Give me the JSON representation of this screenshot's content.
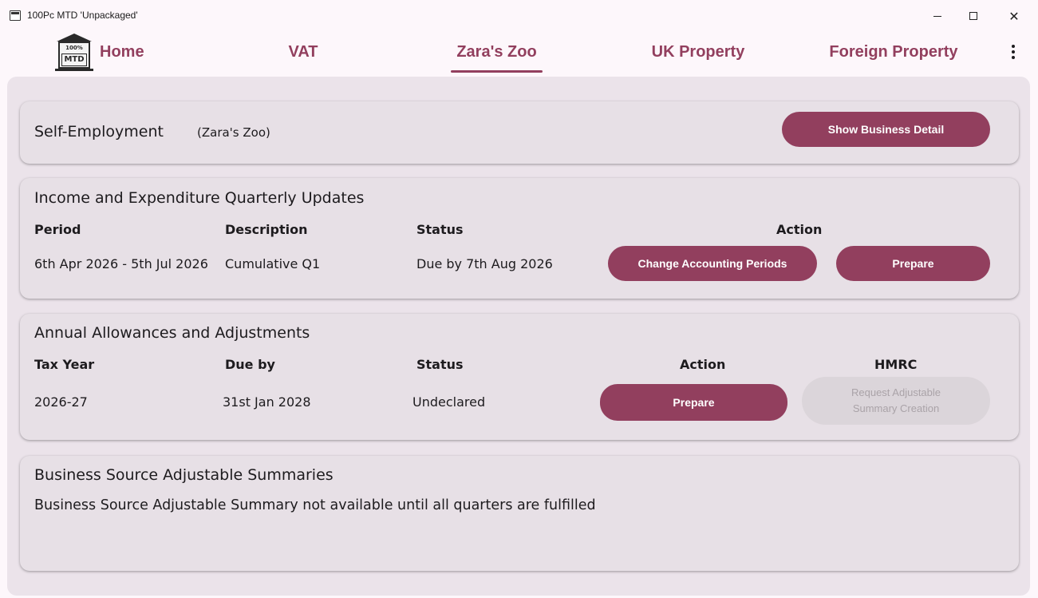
{
  "window": {
    "title": "100Pc MTD 'Unpackaged'",
    "minimize_icon": "minimize-icon",
    "maximize_icon": "maximize-icon",
    "close_glyph": "✕"
  },
  "logo": {
    "pct": "100%",
    "mtd": "MTD"
  },
  "nav": {
    "tabs": [
      {
        "label": "Home"
      },
      {
        "label": "VAT"
      },
      {
        "label": "Zara's Zoo",
        "selected": true
      },
      {
        "label": "UK Property"
      },
      {
        "label": "Foreign Property"
      }
    ],
    "menu_icon": "more-vert-icon"
  },
  "colors": {
    "accent": "#923f5e",
    "card_bg": "#e7e0e6",
    "main_bg": "#ebe3ea",
    "disabled_bg": "#dbd5da"
  },
  "self_employment": {
    "title": "Self-Employment",
    "business": "(Zara's Zoo)",
    "show_detail_button": "Show Business Detail"
  },
  "quarterly": {
    "title": "Income and Expenditure Quarterly Updates",
    "headers": {
      "period": "Period",
      "description": "Description",
      "status": "Status",
      "action": "Action"
    },
    "row": {
      "period": "6th Apr 2026 - 5th Jul 2026",
      "description": "Cumulative Q1",
      "status": "Due by 7th Aug 2026",
      "change_button": "Change Accounting Periods",
      "prepare_button": "Prepare"
    }
  },
  "annual": {
    "title": "Annual Allowances and Adjustments",
    "headers": {
      "tax_year": "Tax Year",
      "due_by": "Due by",
      "status": "Status",
      "action": "Action",
      "hmrc": "HMRC"
    },
    "row": {
      "tax_year": "2026-27",
      "due_by": "31st Jan 2028",
      "status": "Undeclared",
      "prepare_button": "Prepare",
      "request_button_line1": "Request Adjustable",
      "request_button_line2": "Summary Creation"
    }
  },
  "summaries": {
    "title": "Business Source Adjustable Summaries",
    "message": "Business Source Adjustable Summary not available until all quarters are fulfilled"
  }
}
